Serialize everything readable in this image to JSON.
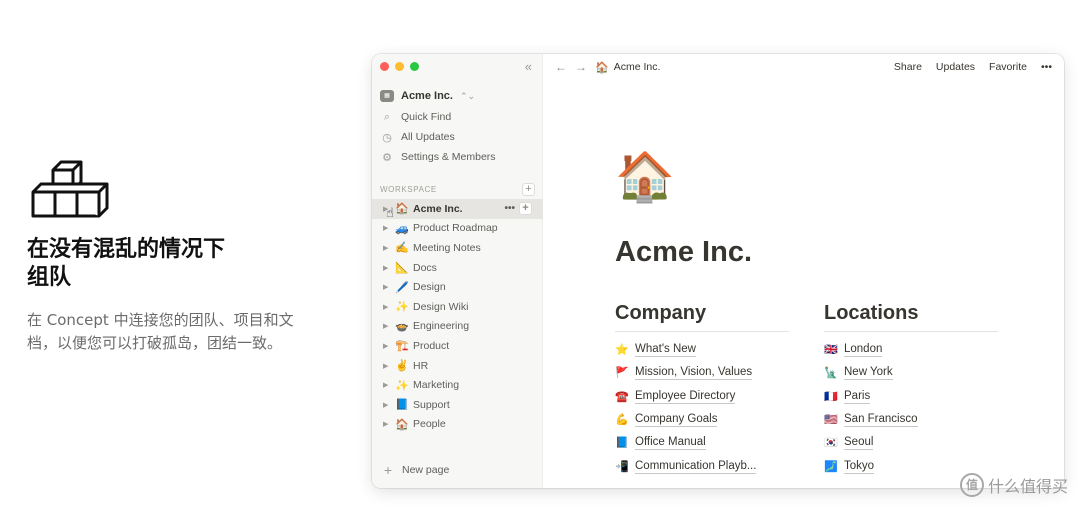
{
  "hero": {
    "title": "在没有混乱的情况下组队",
    "subtitle": "在 Concept 中连接您的团队、项目和文档，以便您可以打破孤岛，团结一致。"
  },
  "window": {
    "collapse_icon": "«",
    "workspace": {
      "name": "Acme Inc.",
      "chevron": "⌃⌄"
    },
    "nav": [
      {
        "icon": "search-icon",
        "glyph": "⌕",
        "label": "Quick Find"
      },
      {
        "icon": "clock-icon",
        "glyph": "◷",
        "label": "All Updates"
      },
      {
        "icon": "gear-icon",
        "glyph": "⚙",
        "label": "Settings & Members"
      }
    ],
    "section_label": "WORKSPACE",
    "tree": [
      {
        "emoji": "🏠",
        "label": "Acme Inc.",
        "active": true
      },
      {
        "emoji": "🚙",
        "label": "Product Roadmap"
      },
      {
        "emoji": "✍️",
        "label": "Meeting Notes"
      },
      {
        "emoji": "📐",
        "label": "Docs"
      },
      {
        "emoji": "🖊️",
        "label": "Design"
      },
      {
        "emoji": "✨",
        "label": "Design Wiki"
      },
      {
        "emoji": "🍲",
        "label": "Engineering"
      },
      {
        "emoji": "🏗️",
        "label": "Product"
      },
      {
        "emoji": "✌️",
        "label": "HR"
      },
      {
        "emoji": "✨",
        "label": "Marketing"
      },
      {
        "emoji": "📘",
        "label": "Support"
      },
      {
        "emoji": "🏠",
        "label": "People"
      }
    ],
    "new_page": "New page",
    "topbar": {
      "breadcrumb_emoji": "🏠",
      "breadcrumb": "Acme Inc.",
      "share": "Share",
      "updates": "Updates",
      "favorite": "Favorite",
      "more": "•••"
    },
    "page": {
      "emoji": "🏠",
      "title": "Acme Inc.",
      "company": {
        "heading": "Company",
        "links": [
          {
            "emoji": "⭐",
            "label": "What's New"
          },
          {
            "emoji": "🚩",
            "label": "Mission, Vision, Values"
          },
          {
            "emoji": "☎️",
            "label": "Employee Directory"
          },
          {
            "emoji": "💪",
            "label": "Company Goals"
          },
          {
            "emoji": "📘",
            "label": "Office Manual"
          },
          {
            "emoji": "📲",
            "label": "Communication Playb..."
          }
        ]
      },
      "locations": {
        "heading": "Locations",
        "links": [
          {
            "emoji": "🇬🇧",
            "label": "London"
          },
          {
            "emoji": "🗽",
            "label": "New York"
          },
          {
            "emoji": "🇫🇷",
            "label": "Paris"
          },
          {
            "emoji": "🇺🇸",
            "label": "San Francisco"
          },
          {
            "emoji": "🇰🇷",
            "label": "Seoul"
          },
          {
            "emoji": "🗾",
            "label": "Tokyo"
          }
        ]
      }
    }
  },
  "watermark": {
    "logo": "值",
    "text": "什么值得买"
  }
}
